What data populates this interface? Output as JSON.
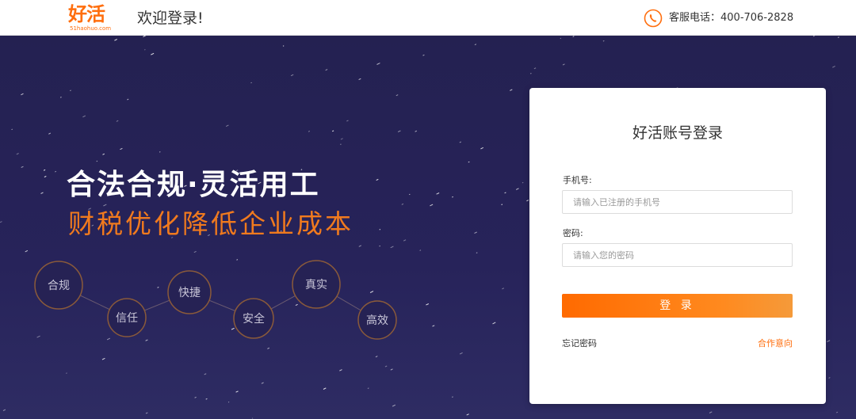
{
  "header": {
    "logo_text": "好活",
    "logo_subtext": "51haohuo.com",
    "welcome": "欢迎登录!",
    "service_label": "客服电话：400-706-2828"
  },
  "hero": {
    "slogan_main": "合法合规·灵活用工",
    "slogan_sub": "财税优化降低企业成本",
    "features": [
      "合规",
      "信任",
      "快捷",
      "安全",
      "真实",
      "高效"
    ]
  },
  "login": {
    "title": "好活账号登录",
    "phone_label": "手机号:",
    "phone_placeholder": "请输入已注册的手机号",
    "password_label": "密码:",
    "password_placeholder": "请输入您的密码",
    "submit_label": "登 录",
    "forgot_label": "忘记密码",
    "cooperate_label": "合作意向"
  },
  "colors": {
    "brand": "#ff6e0d",
    "hero_bg": "#26225a",
    "slogan_sub": "#f07a1e"
  },
  "icons": {
    "phone": "phone-icon"
  }
}
